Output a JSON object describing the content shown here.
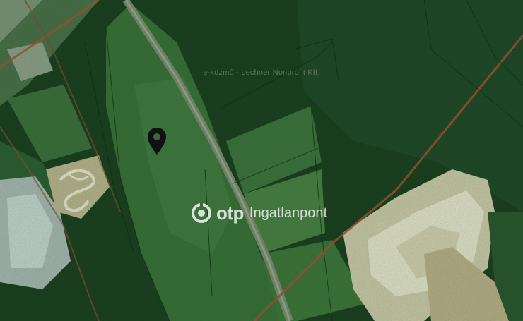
{
  "map": {
    "view": "satellite",
    "attribution": "e-közmű - Lechner Nonprofit Kft.",
    "watermark": {
      "brand": "otp",
      "product": "Ingatlanpont",
      "icon": "otp-logo-icon"
    },
    "marker": {
      "icon": "location-pin-icon",
      "color": "#111111"
    },
    "colors": {
      "forest": "#1d3b22",
      "meadow": "#3f6f3c",
      "road": "#8a8f7c",
      "boundary_line": "#b5503c",
      "quarry": "#d9d4c2"
    }
  }
}
